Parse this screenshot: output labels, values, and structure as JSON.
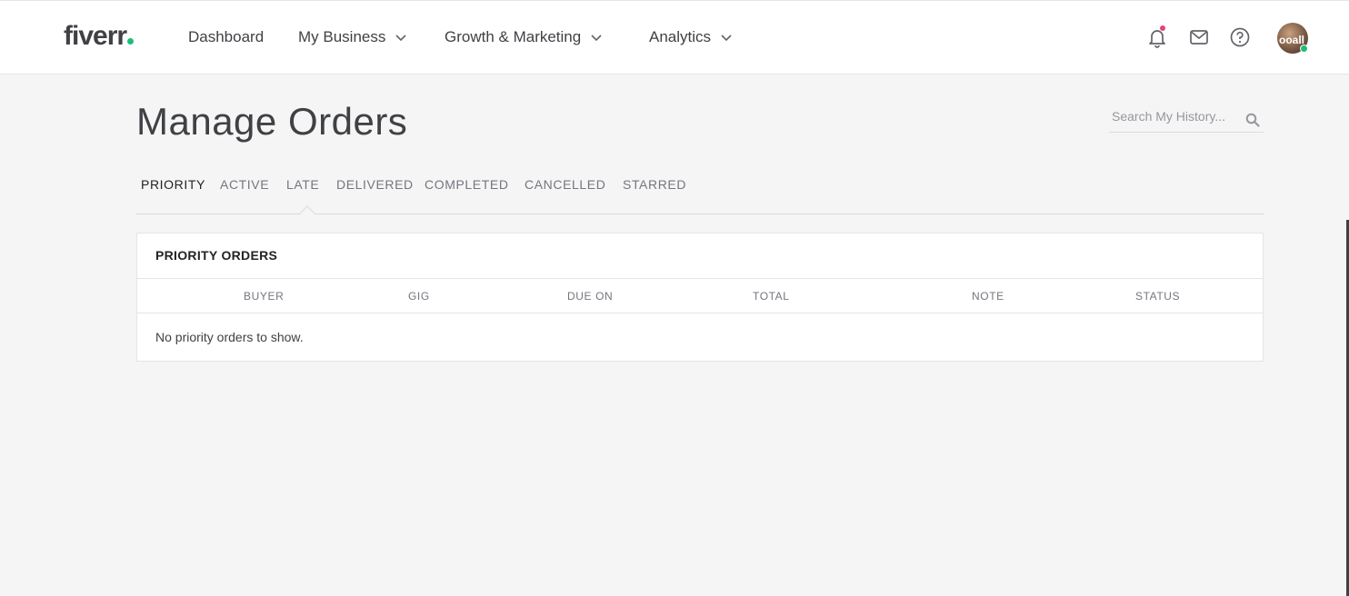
{
  "header": {
    "logo": "fiverr",
    "nav": [
      {
        "label": "Dashboard",
        "dropdown": false
      },
      {
        "label": "My Business",
        "dropdown": true
      },
      {
        "label": "Growth & Marketing",
        "dropdown": true
      },
      {
        "label": "Analytics",
        "dropdown": true
      }
    ],
    "icons": [
      "bell-icon",
      "envelope-icon",
      "help-icon"
    ],
    "avatar_text": "ooall",
    "accent_color": "#1dbf73",
    "notification_color": "#e0457b"
  },
  "main": {
    "title": "Manage Orders",
    "search": {
      "placeholder": "Search My History..."
    },
    "tabs": [
      "PRIORITY",
      "ACTIVE",
      "LATE",
      "DELIVERED",
      "COMPLETED",
      "CANCELLED",
      "STARRED"
    ],
    "active_tab": "PRIORITY",
    "panel": {
      "title": "PRIORITY ORDERS",
      "columns": [
        "BUYER",
        "GIG",
        "DUE ON",
        "TOTAL",
        "NOTE",
        "STATUS"
      ],
      "empty_message": "No priority orders to show."
    }
  }
}
